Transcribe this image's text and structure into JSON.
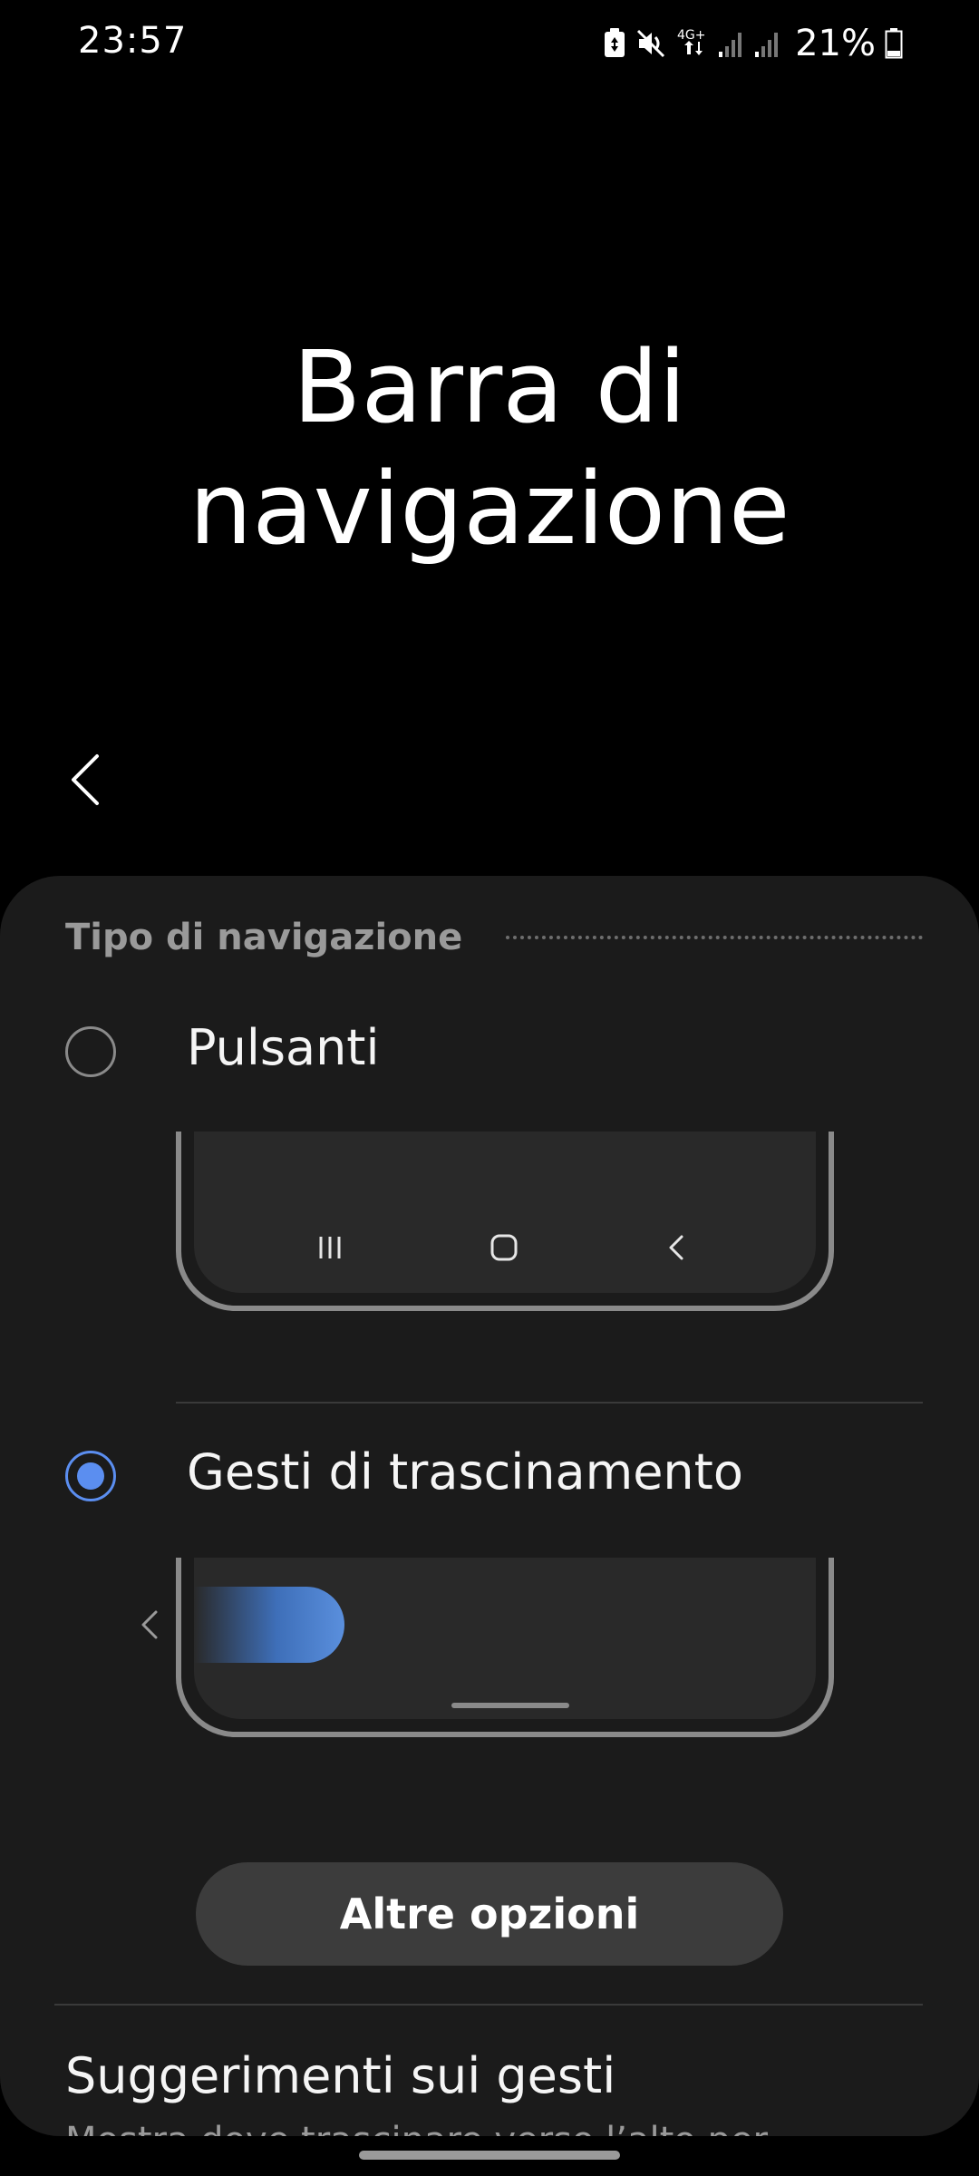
{
  "status_bar": {
    "time": "23:57",
    "network": "4G+",
    "battery": "21%",
    "icons": [
      "battery-saver-icon",
      "mute-icon",
      "network-4g-icon",
      "signal-1-icon",
      "signal-2-icon",
      "battery-icon"
    ]
  },
  "header": {
    "title_line1": "Barra di",
    "title_line2": "navigazione"
  },
  "section": {
    "title": "Tipo di navigazione"
  },
  "options": [
    {
      "label": "Pulsanti",
      "selected": false,
      "preview_icons": [
        "recent-apps-icon",
        "home-icon",
        "back-icon"
      ]
    },
    {
      "label": "Gesti di trascinamento",
      "selected": true,
      "preview_icons": [
        "gesture-back-arrow-icon",
        "gesture-handle",
        "home-bar"
      ]
    }
  ],
  "buttons": {
    "more_options": "Altre opzioni"
  },
  "tips": {
    "title": "Suggerimenti sui gesti",
    "subtitle": "Mostra dove trascinare verso l’alto per"
  },
  "colors": {
    "accent": "#5b8ef0",
    "card_background": "#1b1b1b",
    "button_background": "#3c3c3c"
  }
}
